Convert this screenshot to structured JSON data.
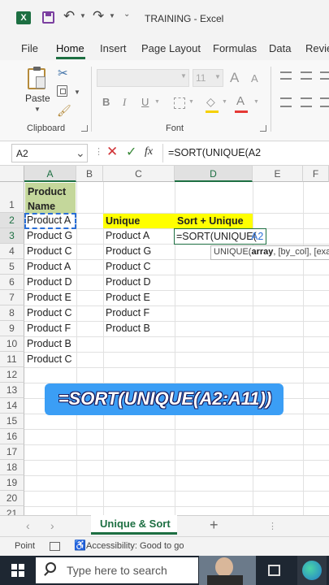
{
  "titlebar": {
    "doc_title": "TRAINING  -  Excel",
    "colors": {
      "excel_green": "#1d6f42",
      "save_purple": "#7b3fa0"
    }
  },
  "ribbon_tabs": [
    "File",
    "Home",
    "Insert",
    "Page Layout",
    "Formulas",
    "Data",
    "Revie"
  ],
  "ribbon": {
    "paste_label": "Paste",
    "clipboard_label": "Clipboard",
    "font_label": "Font",
    "font_size": "11",
    "grow_font": "A",
    "shrink_font": "A",
    "bold": "B",
    "italic": "I",
    "underline": "U"
  },
  "formula_bar": {
    "name_box": "A2",
    "fx": "fx",
    "formula": "=SORT(UNIQUE(A2"
  },
  "columns": [
    "A",
    "B",
    "C",
    "D",
    "E",
    "F"
  ],
  "rows": [
    "1",
    "2",
    "3",
    "4",
    "5",
    "6",
    "7",
    "8",
    "9",
    "10",
    "11",
    "12",
    "13",
    "14",
    "15",
    "16",
    "17",
    "18",
    "19",
    "20",
    "21"
  ],
  "cells": {
    "a1": "Product Name",
    "col_a": [
      "Product A",
      "Product G",
      "Product C",
      "Product A",
      "Product D",
      "Product E",
      "Product C",
      "Product F",
      "Product B",
      "Product C"
    ],
    "c2": "Unique",
    "col_c": [
      "Product A",
      "Product G",
      "Product C",
      "Product D",
      "Product E",
      "Product F",
      "Product B"
    ],
    "d2": "Sort + Unique",
    "d3_prefix": "=SORT(UNIQUE(",
    "d3_ref": "A2"
  },
  "tooltip": {
    "fn": "UNIQUE(",
    "arg1": "array",
    "rest": ", [by_col], [exa"
  },
  "banner": {
    "text": "=SORT(UNIQUE(A2:A11))",
    "color": "#3b9ef5"
  },
  "sheet_tab": "Unique & Sort",
  "status": {
    "mode": "Point",
    "accessibility": "Accessibility: Good to go"
  },
  "taskbar": {
    "search_placeholder": "Type here to search"
  }
}
